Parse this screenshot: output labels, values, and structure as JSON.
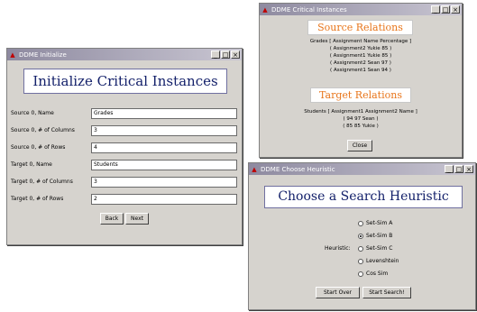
{
  "init_window": {
    "title": "DDME Initialize",
    "heading": "Initialize Critical Instances",
    "fields": [
      {
        "label": "Source 0, Name",
        "value": "Grades"
      },
      {
        "label": "Source 0, # of Columns",
        "value": "3"
      },
      {
        "label": "Source 0, # of Rows",
        "value": "4"
      },
      {
        "label": "Target 0, Name",
        "value": "Students"
      },
      {
        "label": "Target 0, # of Columns",
        "value": "3"
      },
      {
        "label": "Target 0, # of Rows",
        "value": "2"
      }
    ],
    "back_label": "Back",
    "next_label": "Next"
  },
  "critical_window": {
    "title": "DDME Critical Instances",
    "source_heading": "Source Relations",
    "source_lines": [
      "Grades [ Assignment Name Percentage ]",
      "( Assignment2 Yukie 85 )",
      "( Assignment1 Yukie 85 )",
      "( Assignment2 Sean 97 )",
      "( Assignment1 Sean 94 )"
    ],
    "target_heading": "Target Relations",
    "target_lines": [
      "Students [ Assignment1 Assignment2 Name ]",
      "( 94 97 Sean )",
      "( 85 85 Yukie )"
    ],
    "close_label": "Close"
  },
  "heuristic_window": {
    "title": "DDME Choose Heuristic",
    "heading": "Choose a Search Heuristic",
    "heuristic_label": "Heuristic:",
    "options": [
      {
        "label": "Set-Sim A",
        "selected": false
      },
      {
        "label": "Set-Sim B",
        "selected": true
      },
      {
        "label": "Set-Sim C",
        "selected": false
      },
      {
        "label": "Levenshtein",
        "selected": false
      },
      {
        "label": "Cos Sim",
        "selected": false
      }
    ],
    "start_over_label": "Start Over",
    "start_search_label": "Start Search!"
  },
  "window_controls": {
    "minimize": "_",
    "maximize": "□",
    "close": "×"
  },
  "colors": {
    "heading_text": "#13206a",
    "orange_heading": "#e8751a",
    "window_bg": "#d6d3ce"
  }
}
